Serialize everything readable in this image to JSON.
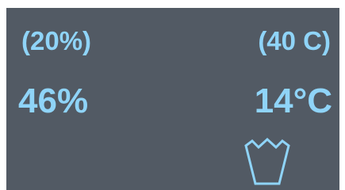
{
  "display": {
    "humidity_setpoint": "(20%)",
    "temperature_setpoint": "(40 C)",
    "humidity_reading": "46%",
    "temperature_reading": "14°C",
    "icon": "water-container-icon"
  },
  "colors": {
    "background": "#525a64",
    "text": "#8fd4f8"
  }
}
